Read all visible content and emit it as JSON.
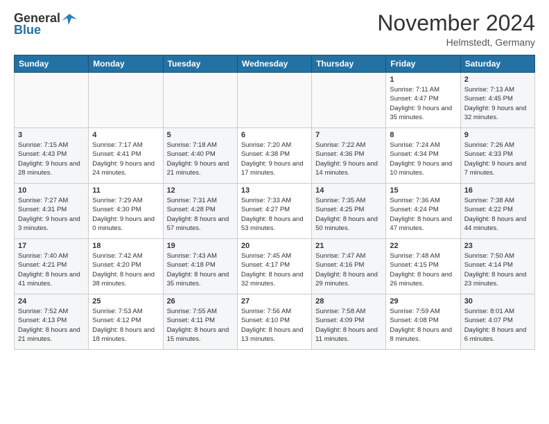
{
  "header": {
    "logo_general": "General",
    "logo_blue": "Blue",
    "month_title": "November 2024",
    "location": "Helmstedt, Germany"
  },
  "calendar": {
    "days_of_week": [
      "Sunday",
      "Monday",
      "Tuesday",
      "Wednesday",
      "Thursday",
      "Friday",
      "Saturday"
    ],
    "weeks": [
      [
        {
          "day": "",
          "info": ""
        },
        {
          "day": "",
          "info": ""
        },
        {
          "day": "",
          "info": ""
        },
        {
          "day": "",
          "info": ""
        },
        {
          "day": "",
          "info": ""
        },
        {
          "day": "1",
          "info": "Sunrise: 7:11 AM\nSunset: 4:47 PM\nDaylight: 9 hours and 35 minutes."
        },
        {
          "day": "2",
          "info": "Sunrise: 7:13 AM\nSunset: 4:45 PM\nDaylight: 9 hours and 32 minutes."
        }
      ],
      [
        {
          "day": "3",
          "info": "Sunrise: 7:15 AM\nSunset: 4:43 PM\nDaylight: 9 hours and 28 minutes."
        },
        {
          "day": "4",
          "info": "Sunrise: 7:17 AM\nSunset: 4:41 PM\nDaylight: 9 hours and 24 minutes."
        },
        {
          "day": "5",
          "info": "Sunrise: 7:18 AM\nSunset: 4:40 PM\nDaylight: 9 hours and 21 minutes."
        },
        {
          "day": "6",
          "info": "Sunrise: 7:20 AM\nSunset: 4:38 PM\nDaylight: 9 hours and 17 minutes."
        },
        {
          "day": "7",
          "info": "Sunrise: 7:22 AM\nSunset: 4:36 PM\nDaylight: 9 hours and 14 minutes."
        },
        {
          "day": "8",
          "info": "Sunrise: 7:24 AM\nSunset: 4:34 PM\nDaylight: 9 hours and 10 minutes."
        },
        {
          "day": "9",
          "info": "Sunrise: 7:26 AM\nSunset: 4:33 PM\nDaylight: 9 hours and 7 minutes."
        }
      ],
      [
        {
          "day": "10",
          "info": "Sunrise: 7:27 AM\nSunset: 4:31 PM\nDaylight: 9 hours and 3 minutes."
        },
        {
          "day": "11",
          "info": "Sunrise: 7:29 AM\nSunset: 4:30 PM\nDaylight: 9 hours and 0 minutes."
        },
        {
          "day": "12",
          "info": "Sunrise: 7:31 AM\nSunset: 4:28 PM\nDaylight: 8 hours and 57 minutes."
        },
        {
          "day": "13",
          "info": "Sunrise: 7:33 AM\nSunset: 4:27 PM\nDaylight: 8 hours and 53 minutes."
        },
        {
          "day": "14",
          "info": "Sunrise: 7:35 AM\nSunset: 4:25 PM\nDaylight: 8 hours and 50 minutes."
        },
        {
          "day": "15",
          "info": "Sunrise: 7:36 AM\nSunset: 4:24 PM\nDaylight: 8 hours and 47 minutes."
        },
        {
          "day": "16",
          "info": "Sunrise: 7:38 AM\nSunset: 4:22 PM\nDaylight: 8 hours and 44 minutes."
        }
      ],
      [
        {
          "day": "17",
          "info": "Sunrise: 7:40 AM\nSunset: 4:21 PM\nDaylight: 8 hours and 41 minutes."
        },
        {
          "day": "18",
          "info": "Sunrise: 7:42 AM\nSunset: 4:20 PM\nDaylight: 8 hours and 38 minutes."
        },
        {
          "day": "19",
          "info": "Sunrise: 7:43 AM\nSunset: 4:18 PM\nDaylight: 8 hours and 35 minutes."
        },
        {
          "day": "20",
          "info": "Sunrise: 7:45 AM\nSunset: 4:17 PM\nDaylight: 8 hours and 32 minutes."
        },
        {
          "day": "21",
          "info": "Sunrise: 7:47 AM\nSunset: 4:16 PM\nDaylight: 8 hours and 29 minutes."
        },
        {
          "day": "22",
          "info": "Sunrise: 7:48 AM\nSunset: 4:15 PM\nDaylight: 8 hours and 26 minutes."
        },
        {
          "day": "23",
          "info": "Sunrise: 7:50 AM\nSunset: 4:14 PM\nDaylight: 8 hours and 23 minutes."
        }
      ],
      [
        {
          "day": "24",
          "info": "Sunrise: 7:52 AM\nSunset: 4:13 PM\nDaylight: 8 hours and 21 minutes."
        },
        {
          "day": "25",
          "info": "Sunrise: 7:53 AM\nSunset: 4:12 PM\nDaylight: 8 hours and 18 minutes."
        },
        {
          "day": "26",
          "info": "Sunrise: 7:55 AM\nSunset: 4:11 PM\nDaylight: 8 hours and 15 minutes."
        },
        {
          "day": "27",
          "info": "Sunrise: 7:56 AM\nSunset: 4:10 PM\nDaylight: 8 hours and 13 minutes."
        },
        {
          "day": "28",
          "info": "Sunrise: 7:58 AM\nSunset: 4:09 PM\nDaylight: 8 hours and 11 minutes."
        },
        {
          "day": "29",
          "info": "Sunrise: 7:59 AM\nSunset: 4:08 PM\nDaylight: 8 hours and 8 minutes."
        },
        {
          "day": "30",
          "info": "Sunrise: 8:01 AM\nSunset: 4:07 PM\nDaylight: 8 hours and 6 minutes."
        }
      ]
    ]
  }
}
